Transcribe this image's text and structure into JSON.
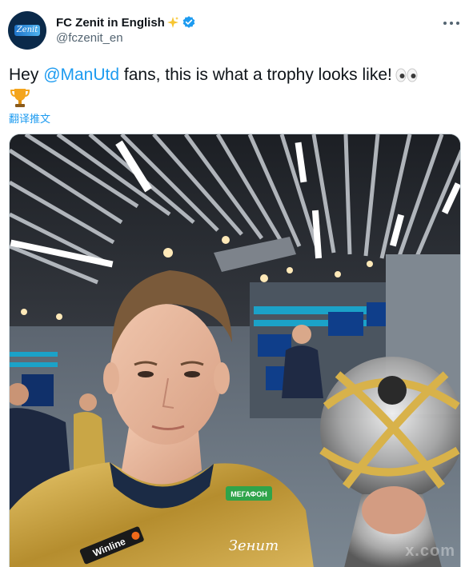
{
  "tweet": {
    "display_name": "FC Zenit in English",
    "handle": "@fczenit_en",
    "text_before": "Hey ",
    "mention": "@ManUtd",
    "text_after": " fans, this is what a trophy looks like!",
    "translate_label": "翻译推文",
    "avatar_crest_text": "Zenit"
  },
  "media": {
    "jersey_sponsor": "МЕГАФОН",
    "jersey_logo": "Зенит",
    "sleeve_sponsor": "Winline",
    "watermark": "x.com"
  },
  "colors": {
    "link": "#1d9bf0",
    "verified": "#1d9bf0",
    "jersey_gold": "#c9a646"
  },
  "icons": [
    "sparkle-icon",
    "verified-badge-icon",
    "more-options-icon",
    "eyes-emoji-icon",
    "trophy-emoji-icon"
  ]
}
